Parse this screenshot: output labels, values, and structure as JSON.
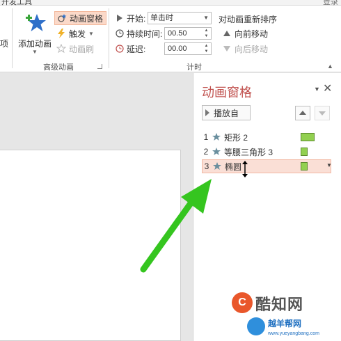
{
  "ribbon": {
    "tabs": {
      "developer": "开发工具",
      "right_label": "登录"
    },
    "partial_label": "项",
    "add_animation": {
      "label": "添加动画"
    },
    "animation_pane_button": "动画窗格",
    "trigger_button": "触发",
    "animation_painter": "动画刷",
    "group_advanced": "高级动画",
    "start": {
      "label": "开始:",
      "value": "单击时"
    },
    "duration": {
      "label": "持续时间:",
      "value": "00.50"
    },
    "delay": {
      "label": "延迟:",
      "value": "00.00"
    },
    "group_timing": "计时",
    "reorder": {
      "title": "对动画重新排序",
      "move_earlier": "向前移动",
      "move_later": "向后移动"
    }
  },
  "pane": {
    "title": "动画窗格",
    "play_button": "播放自",
    "items": [
      {
        "number": "1",
        "name": "矩形 2",
        "selected": false
      },
      {
        "number": "2",
        "name": "等腰三角形 3",
        "selected": false
      },
      {
        "number": "3",
        "name": "椭圆",
        "selected": true
      }
    ]
  },
  "watermark": {
    "brand": "酷知网",
    "brand2": "越羊帮网",
    "url": "www.yueyangbang.com"
  },
  "colors": {
    "accent": "#c0504d",
    "selection": "#fadfd6",
    "timeline": "#92d050",
    "arrow": "#35c51f"
  }
}
